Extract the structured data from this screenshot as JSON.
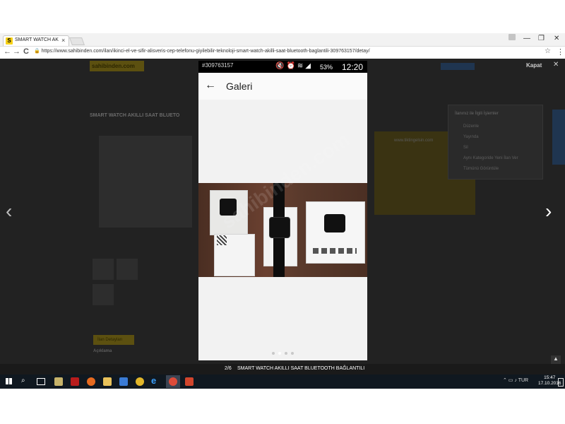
{
  "browser": {
    "tab_title": "SMART WATCH AKILLI S...",
    "tab_favicon": "S",
    "tab_close": "×",
    "url": "https://www.sahibinden.com/ilan/ikinci-el-ve-sifir-alisveris-cep-telefonu-giyilebilir-teknoloji-smart-watch-akilli-saat-bluetooth-baglantili-309763157/detay/",
    "back": "←",
    "forward": "→",
    "reload": "C",
    "bookmark": "☆",
    "menu": "⋮",
    "win_min": "—",
    "win_max": "❐",
    "win_close": "✕"
  },
  "site": {
    "logo": "sahibinden.com",
    "listing_title": "SMART WATCH AKILLI SAAT BLUETO",
    "sidebar_title": "İlanınız ile İlgili İşlemler",
    "sidebar_items": [
      "Düzenle",
      "Yayında",
      "Sil",
      "Aynı Kategoride Yeni İlan Ver",
      "Tümünü Görüntüle"
    ],
    "section_label": "İlan Detayları",
    "description_label": "Açıklama",
    "ad_banner": "www.tiktingelsin.com"
  },
  "gallery": {
    "close_label": "Kapat",
    "close_icon": "✕",
    "prev": "‹",
    "next": "›",
    "counter": "2/6",
    "caption": "SMART WATCH AKILLI SAAT BLUETOOTH BAĞLANTILI",
    "scroll_top": "▲"
  },
  "phone": {
    "listing_id": "#309763157",
    "battery": "53%",
    "time": "12:20",
    "title": "Galeri",
    "back_icon": "←",
    "watermark": "sahibinden.com",
    "active_dot": 1,
    "dot_count": 4
  },
  "taskbar": {
    "lang": "TUR",
    "time": "15:47",
    "date": "17.10.2016"
  },
  "colors": {
    "page_overlay": "#222222",
    "logo_bg": "#f7d117",
    "taskbar": "#101820"
  }
}
